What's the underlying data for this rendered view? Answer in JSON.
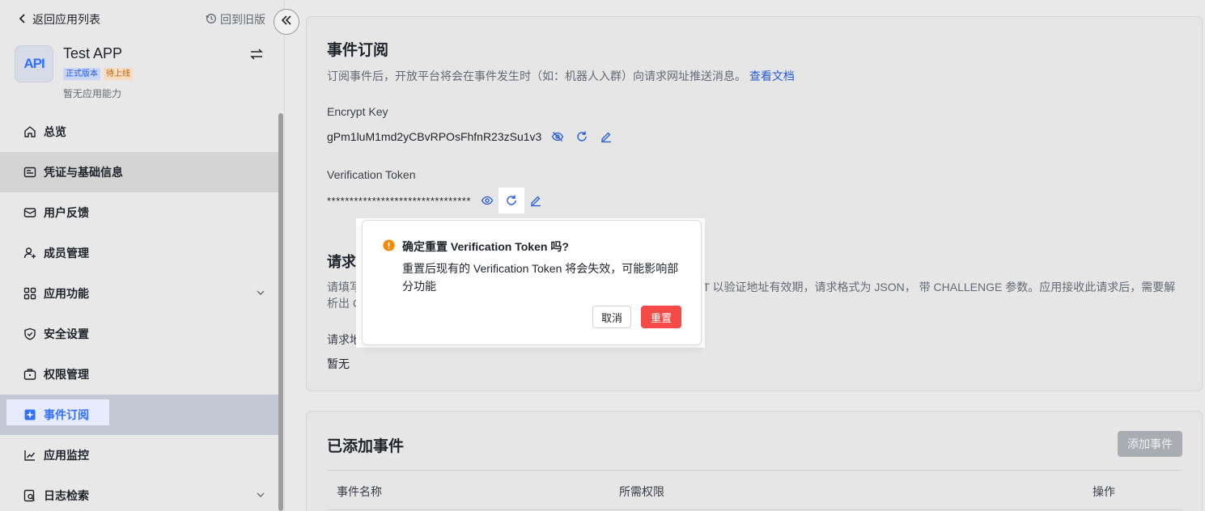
{
  "sidebar": {
    "back_label": "返回应用列表",
    "old_version_label": "回到旧版",
    "app": {
      "logo_text": "API",
      "name": "Test APP",
      "badge_official": "正式版本",
      "badge_pending": "待上线",
      "description": "暂无应用能力"
    },
    "items": [
      {
        "label": "总览",
        "icon": "home-icon"
      },
      {
        "label": "凭证与基础信息",
        "icon": "credential-icon"
      },
      {
        "label": "用户反馈",
        "icon": "mail-icon"
      },
      {
        "label": "成员管理",
        "icon": "user-add-icon"
      },
      {
        "label": "应用功能",
        "icon": "grid-icon"
      },
      {
        "label": "安全设置",
        "icon": "shield-icon"
      },
      {
        "label": "权限管理",
        "icon": "briefcase-icon"
      },
      {
        "label": "事件订阅",
        "icon": "event-icon"
      },
      {
        "label": "应用监控",
        "icon": "chart-icon"
      },
      {
        "label": "日志检索",
        "icon": "log-search-icon"
      }
    ]
  },
  "event_card": {
    "title": "事件订阅",
    "description": "订阅事件后，开放平台将会在事件发生时（如：机器人入群）向请求网址推送消息。",
    "doc_link": "查看文档",
    "encrypt_key_label": "Encrypt Key",
    "encrypt_key_value": "gPm1luM1md2yCBvRPOsFhfnR23zSu1v3",
    "token_label": "Verification Token",
    "token_value": "********************************",
    "request_title": "请求地",
    "request_desc_1_left": "请填写",
    "request_desc_1_right": "ST 以验证地址有效期，请求格式为 JSON， 带 CHALLENGE 参数。应用接收此请求后，需要解",
    "request_desc_2_left": "析出 CH",
    "request_url_label": "请求地",
    "request_url_value": "暂无"
  },
  "added_events": {
    "title": "已添加事件",
    "add_button": "添加事件",
    "columns": [
      "事件名称",
      "所需权限",
      "操作"
    ]
  },
  "popover": {
    "title": "确定重置 Verification Token 吗?",
    "body": "重置后现有的 Verification Token 将会失效，可能影响部分功能",
    "cancel_label": "取消",
    "confirm_label": "重置"
  },
  "colors": {
    "accent": "#3370ff",
    "danger": "#f54a45",
    "warning": "#ff8800"
  }
}
